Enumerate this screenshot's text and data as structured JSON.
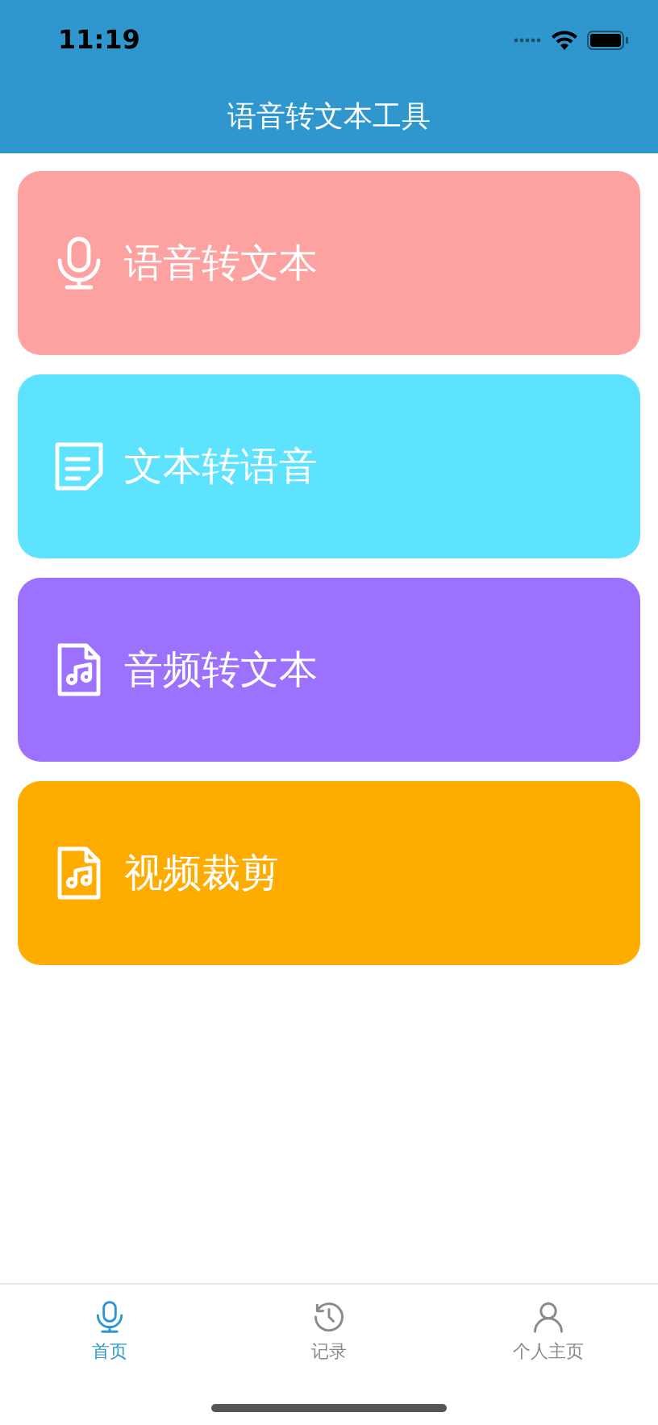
{
  "status_bar": {
    "time": "11:19"
  },
  "nav": {
    "title": "语音转文本工具"
  },
  "cards": [
    {
      "label": "语音转文本",
      "kind": "mic",
      "color": "#fea1a1"
    },
    {
      "label": "文本转语音",
      "kind": "note",
      "color": "#5ee3fe"
    },
    {
      "label": "音频转文本",
      "kind": "audio",
      "color": "#9c71fe"
    },
    {
      "label": "视频裁剪",
      "kind": "audio",
      "color": "#feac00"
    }
  ],
  "tabs": [
    {
      "label": "首页",
      "kind": "mic",
      "selected": true
    },
    {
      "label": "记录",
      "kind": "history",
      "selected": false
    },
    {
      "label": "个人主页",
      "kind": "person",
      "selected": false
    }
  ]
}
